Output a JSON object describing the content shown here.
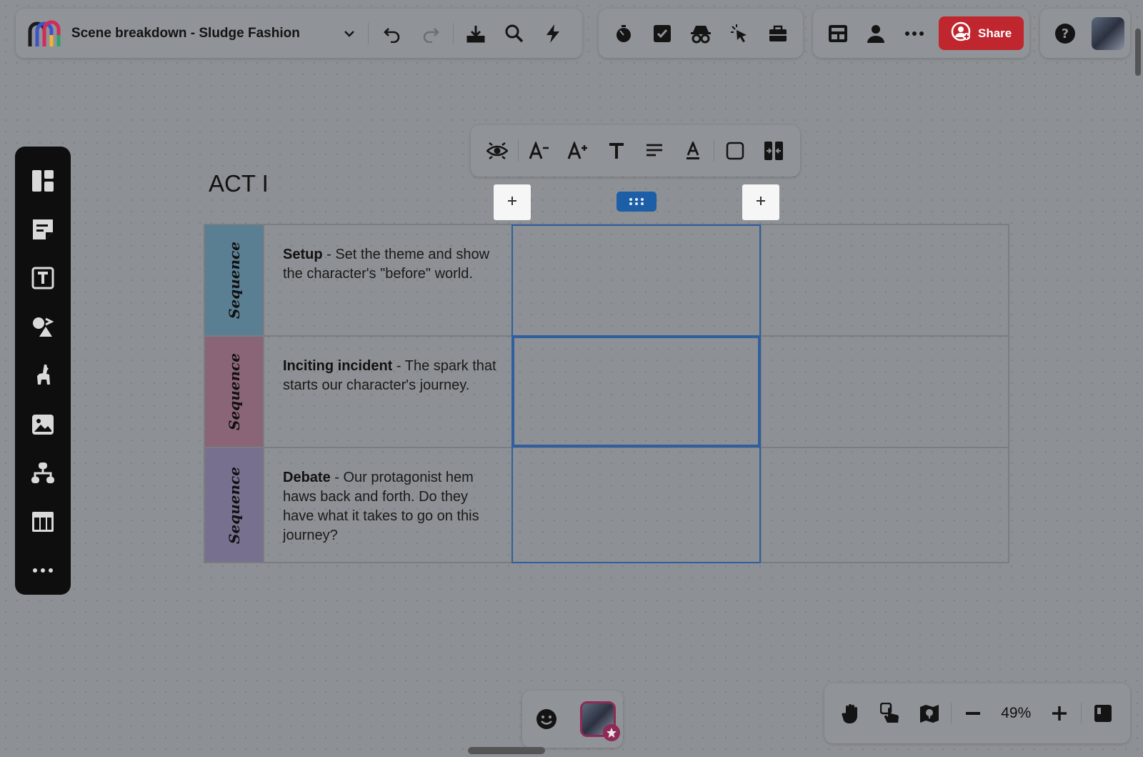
{
  "document": {
    "title": "Scene breakdown - Sludge Fashion"
  },
  "share": {
    "label": "Share"
  },
  "canvas": {
    "act_title": "ACT I",
    "rows": [
      {
        "sequence_label": "Sequence",
        "color": "#5a7f93",
        "heading": "Setup",
        "text": " - Set the theme and show the character's \"before\" world."
      },
      {
        "sequence_label": "Sequence",
        "color": "#8a6577",
        "heading": "Inciting incident",
        "text": " - The spark that starts our character's journey."
      },
      {
        "sequence_label": "Sequence",
        "color": "#78708f",
        "heading": "Debate",
        "text": " - Our protagonist hem haws back and forth. Do they have what it takes to go on this journey?"
      }
    ]
  },
  "zoom": {
    "level": "49%"
  },
  "colors": {
    "share_bg": "#c0262e",
    "selection": "#2f5f9e",
    "handle": "#1d5fa6",
    "avatar_ring": "#8f2a57"
  }
}
